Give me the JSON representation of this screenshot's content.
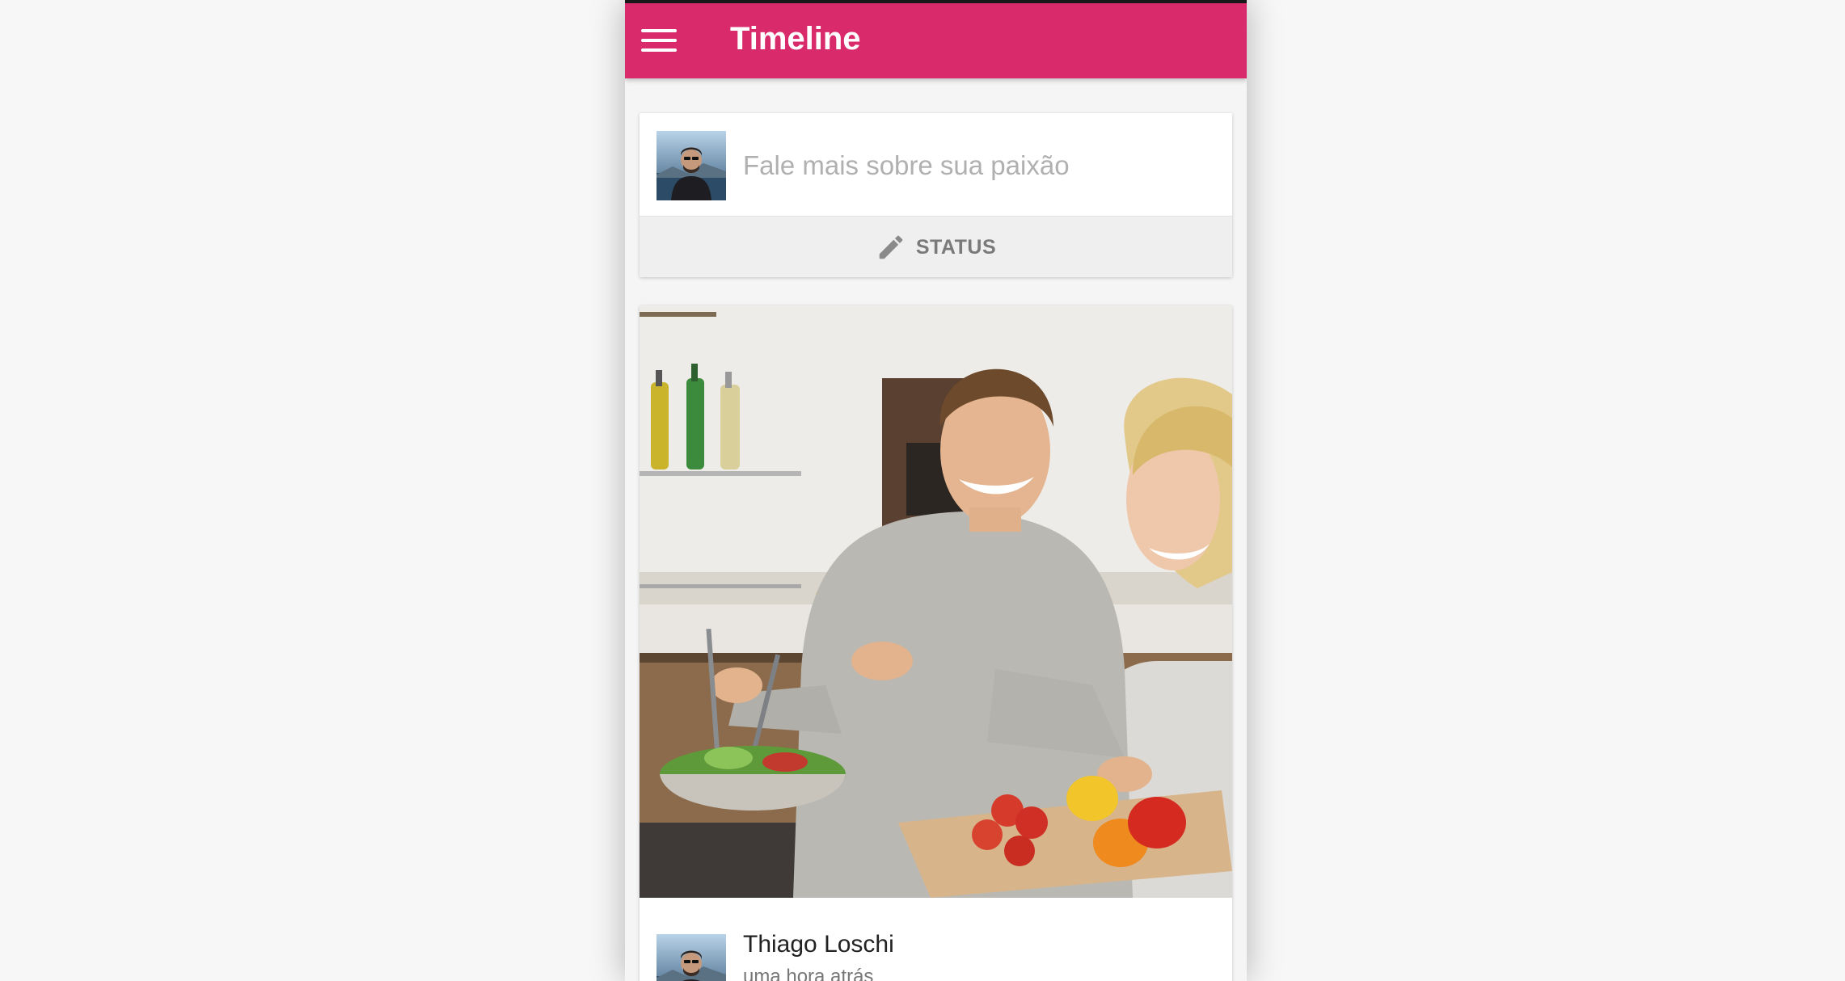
{
  "appbar": {
    "title": "Timeline"
  },
  "composer": {
    "placeholder": "Fale mais sobre sua paixão",
    "status_label": "STATUS"
  },
  "post": {
    "author": "Thiago Loschi",
    "time": "uma hora atrás"
  },
  "colors": {
    "accent": "#d92b6b",
    "background": "#f5f5f5"
  },
  "icons": {
    "menu": "menu-icon",
    "status": "pencil-icon"
  }
}
